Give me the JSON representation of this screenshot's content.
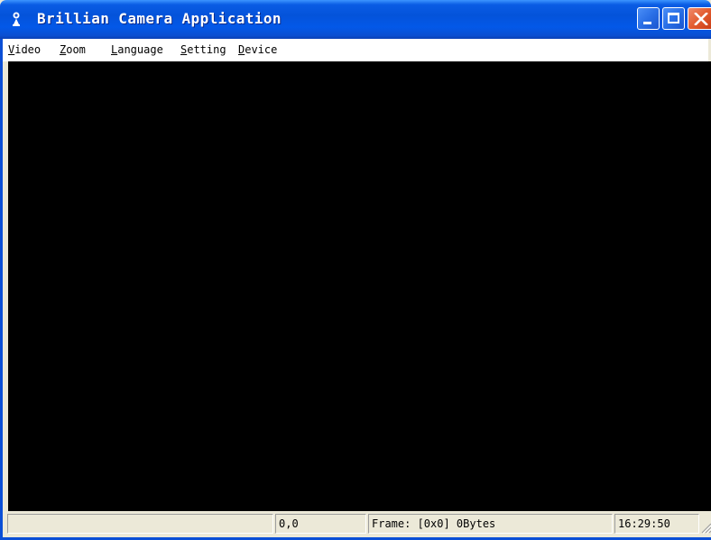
{
  "window": {
    "title": "Brillian Camera Application",
    "icon": "camera-app-icon",
    "controls": {
      "minimize_icon": "minimize-icon",
      "maximize_icon": "maximize-icon",
      "close_icon": "close-icon"
    },
    "colors": {
      "titlebar": "#0453da",
      "close_button": "#e25a2e",
      "video_background": "#000000",
      "chrome": "#ece9d8"
    }
  },
  "menu": {
    "items": [
      {
        "mnemonic": "V",
        "rest": "ideo"
      },
      {
        "mnemonic": "Z",
        "rest": "oom"
      },
      {
        "mnemonic": "L",
        "rest": "anguage"
      },
      {
        "mnemonic": "S",
        "rest": "etting"
      },
      {
        "mnemonic": "D",
        "rest": "evice"
      }
    ]
  },
  "status": {
    "pane1": "",
    "coordinates": "0,0",
    "frame_info": "Frame: [0x0] 0Bytes",
    "time": "16:29:50"
  }
}
